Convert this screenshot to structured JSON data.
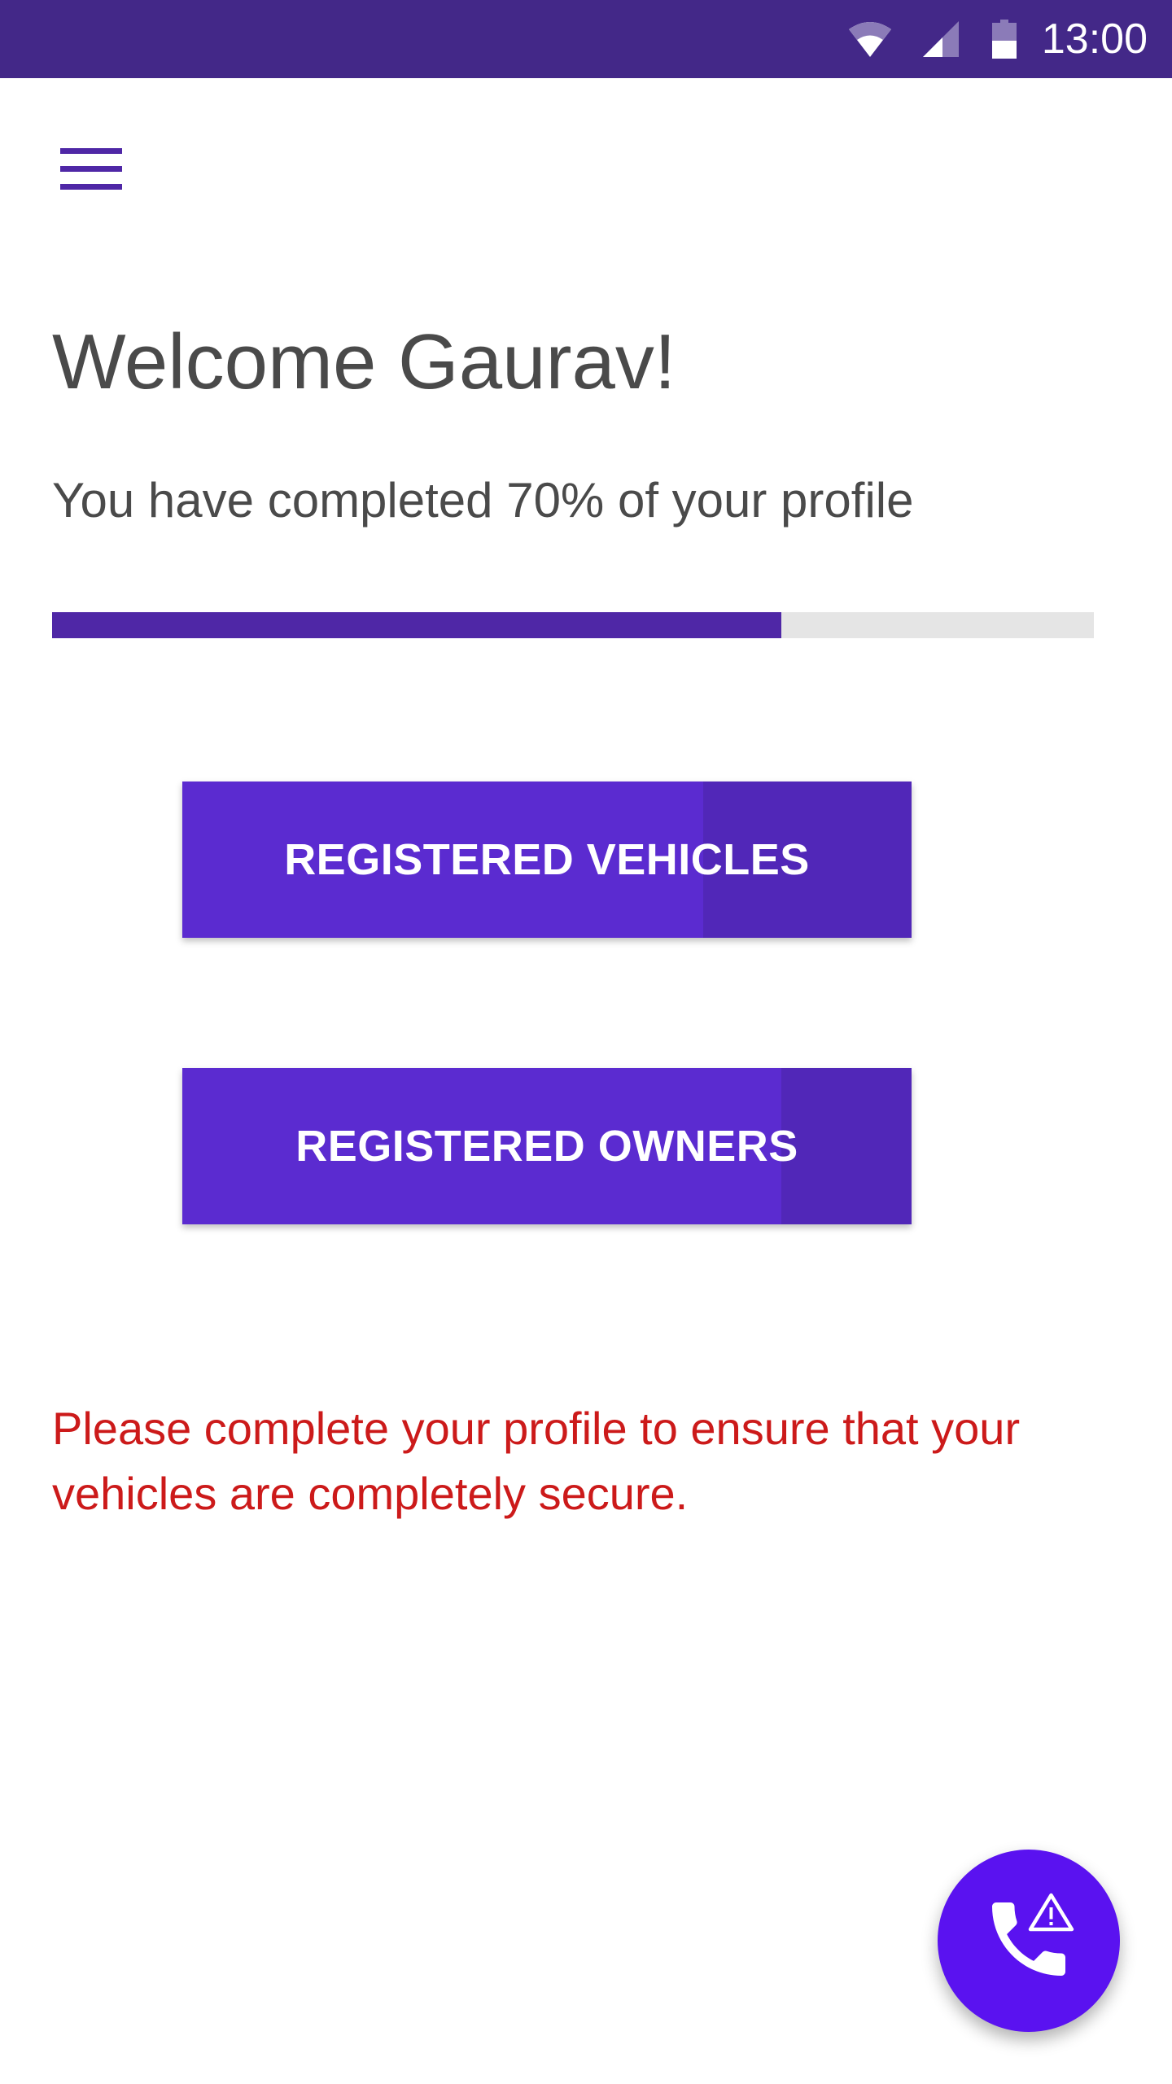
{
  "status_bar": {
    "time": "13:00",
    "icons": [
      "wifi-icon",
      "cell-signal-icon",
      "battery-icon"
    ]
  },
  "header": {
    "menu_icon": "hamburger-menu-icon"
  },
  "main": {
    "welcome_title": "Welcome Gaurav!",
    "progress_text": "You have completed 70% of your profile",
    "progress_fraction": 0.7,
    "buttons": {
      "vehicles_label": "REGISTERED VEHICLES",
      "owners_label": "REGISTERED OWNERS"
    },
    "warning_text": "Please complete your profile to ensure that your vehicles are completely secure."
  },
  "fab": {
    "icon": "emergency-call-icon"
  },
  "colors": {
    "status_bar": "#432888",
    "accent": "#5b2bd0",
    "progress": "#4f27a6",
    "progress_track": "#e5e5e5",
    "warning": "#cc1a1a",
    "fab": "#5a12f0",
    "text": "#4a4a4a"
  }
}
